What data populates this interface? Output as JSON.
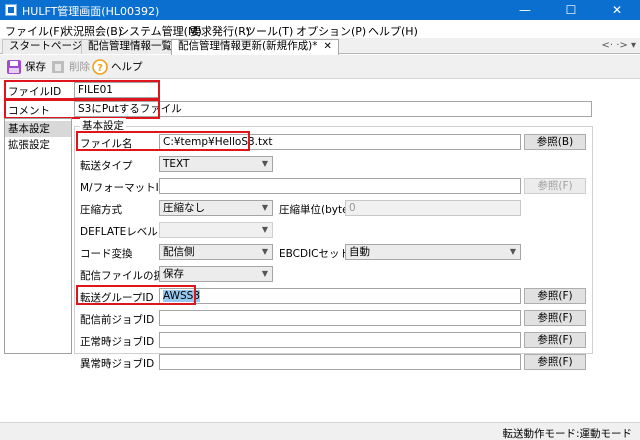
{
  "window": {
    "title": "HULFT管理画面(HL00392)",
    "minimize": "—",
    "maximize": "☐",
    "close": "✕"
  },
  "menu": [
    "ファイル(F)",
    "状況照会(B)",
    "システム管理(M)",
    "要求発行(R)",
    "ツール(T)",
    "オプション(P)",
    "ヘルプ(H)"
  ],
  "tabs": [
    {
      "label": "スタートページ"
    },
    {
      "label": "配信管理情報一覧"
    },
    {
      "label": "配信管理情報更新(新規作成)*",
      "close": "✕"
    }
  ],
  "tab_nav": "<· ·> ▾",
  "toolbar": {
    "save_label": "保存",
    "delete_label": "削除",
    "help_label": "ヘルプ"
  },
  "header": {
    "file_id_label": "ファイルID",
    "file_id_value": "FILE01",
    "comment_label": "コメント",
    "comment_value": "S3にPutするファイル"
  },
  "side": {
    "items": [
      "基本設定",
      "拡張設定"
    ]
  },
  "group": {
    "title": "基本設定",
    "file_name_label": "ファイル名",
    "file_name_value": "C:¥temp¥HelloS3.txt",
    "browse_b": "参照(B)",
    "transfer_type_label": "転送タイプ",
    "transfer_type_value": "TEXT",
    "format_id_label": "M/フォーマットID",
    "browse_f": "参照(F)",
    "compress_label": "圧縮方式",
    "compress_value": "圧縮なし",
    "compress_unit_label": "圧縮単位(bytes)",
    "compress_unit_value": "0",
    "deflate_label": "DEFLATEレベル",
    "code_conv_label": "コード変換",
    "code_conv_value": "配信側",
    "ebcdic_label": "EBCDICセット",
    "ebcdic_value": "自動",
    "handling_label": "配信ファイルの扱い",
    "handling_value": "保存",
    "group_id_label": "転送グループID",
    "group_id_value": "AWSS3",
    "pre_job_label": "配信前ジョブID",
    "normal_job_label": "正常時ジョブID",
    "error_job_label": "異常時ジョブID"
  },
  "status": {
    "text": "転送動作モード:運動モード"
  },
  "colors": {
    "titlebar": "#0b6fcf",
    "highlight_box": "#e0151b",
    "selection": "#99c9ef"
  }
}
